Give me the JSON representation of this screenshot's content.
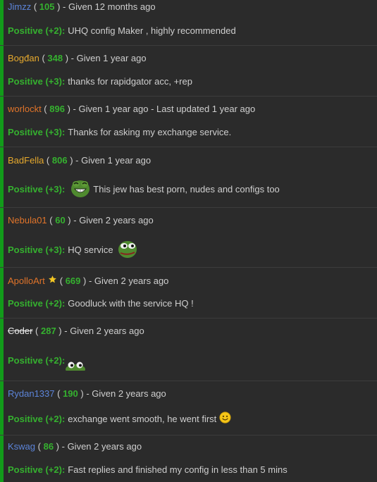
{
  "entries": [
    {
      "user": "Jimzz",
      "color": "blue",
      "score": "105",
      "given": "Given 12 months ago",
      "type": "Positive (+2):",
      "comment": "UHQ config Maker , highly recommended",
      "emoji": ""
    },
    {
      "user": "Bogđan",
      "color": "gold",
      "score": "348",
      "given": "Given 1 year ago",
      "type": "Positive (+3):",
      "comment": "thanks for rapidgator acc, +rep",
      "emoji": ""
    },
    {
      "user": "worlockt",
      "color": "orange",
      "score": "896",
      "given": "Given 1 year ago - Last updated 1 year ago",
      "type": "Positive (+3):",
      "comment": "Thanks for asking my exchange service.",
      "emoji": ""
    },
    {
      "user": "BadFella",
      "color": "gold",
      "score": "806",
      "given": "Given 1 year ago",
      "type": "Positive (+3):",
      "comment": "This jew has best porn, nudes and configs too",
      "emoji": "pepe-laugh-icon"
    },
    {
      "user": "Nebula01",
      "color": "orange",
      "score": "60",
      "given": "Given 2 years ago",
      "type": "Positive (+3):",
      "comment": "HQ service",
      "emoji": "pepe-icon"
    },
    {
      "user": "ApolloArt",
      "color": "orange",
      "score": "669",
      "given": "Given 2 years ago",
      "type": "Positive (+2):",
      "comment": "Goodluck with the service HQ !",
      "emoji": ""
    },
    {
      "user": "Coder",
      "color": "strike",
      "score": "287",
      "given": "Given 2 years ago",
      "type": "Positive (+2):",
      "comment": "",
      "emoji": "frog-peek-icon"
    },
    {
      "user": "Rydan1337",
      "color": "blue",
      "score": "190",
      "given": "Given 2 years ago",
      "type": "Positive (+2):",
      "comment": "exchange went smooth, he went first",
      "emoji": "smiley-icon"
    },
    {
      "user": "Kswag",
      "color": "blue",
      "score": "86",
      "given": "Given 2 years ago",
      "type": "Positive (+2):",
      "comment": "Fast replies and finished my config in less than 5 mins",
      "emoji": ""
    }
  ]
}
